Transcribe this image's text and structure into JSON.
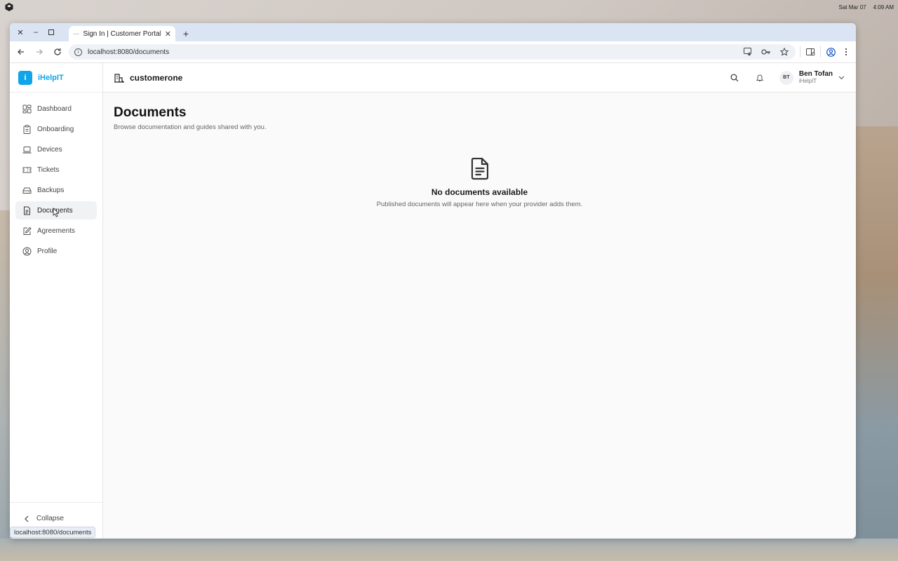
{
  "system": {
    "date": "Sat Mar 07",
    "time": "4:09 AM"
  },
  "browser": {
    "tab_title": "Sign In | Customer Portal",
    "tab_loading": "·····",
    "url": "localhost:8080/documents",
    "status_url": "localhost:8080/documents"
  },
  "brand": {
    "badge": "i",
    "name": "iHelpIT"
  },
  "sidebar": {
    "items": [
      {
        "label": "Dashboard",
        "icon": "dashboard-icon"
      },
      {
        "label": "Onboarding",
        "icon": "clipboard-icon"
      },
      {
        "label": "Devices",
        "icon": "laptop-icon"
      },
      {
        "label": "Tickets",
        "icon": "ticket-icon"
      },
      {
        "label": "Backups",
        "icon": "drive-icon"
      },
      {
        "label": "Documents",
        "icon": "document-icon",
        "active": true
      },
      {
        "label": "Agreements",
        "icon": "pen-icon"
      },
      {
        "label": "Profile",
        "icon": "user-circle-icon"
      }
    ],
    "collapse_label": "Collapse"
  },
  "topbar": {
    "org_name": "customerone",
    "user": {
      "initials": "BT",
      "name": "Ben Tofan",
      "org": "iHelpIT"
    }
  },
  "page": {
    "title": "Documents",
    "subtitle": "Browse documentation and guides shared with you.",
    "empty_title": "No documents available",
    "empty_subtitle": "Published documents will appear here when your provider adds them."
  },
  "colors": {
    "brand": "#0ea5e9",
    "tabstrip": "#dbe4f3"
  }
}
